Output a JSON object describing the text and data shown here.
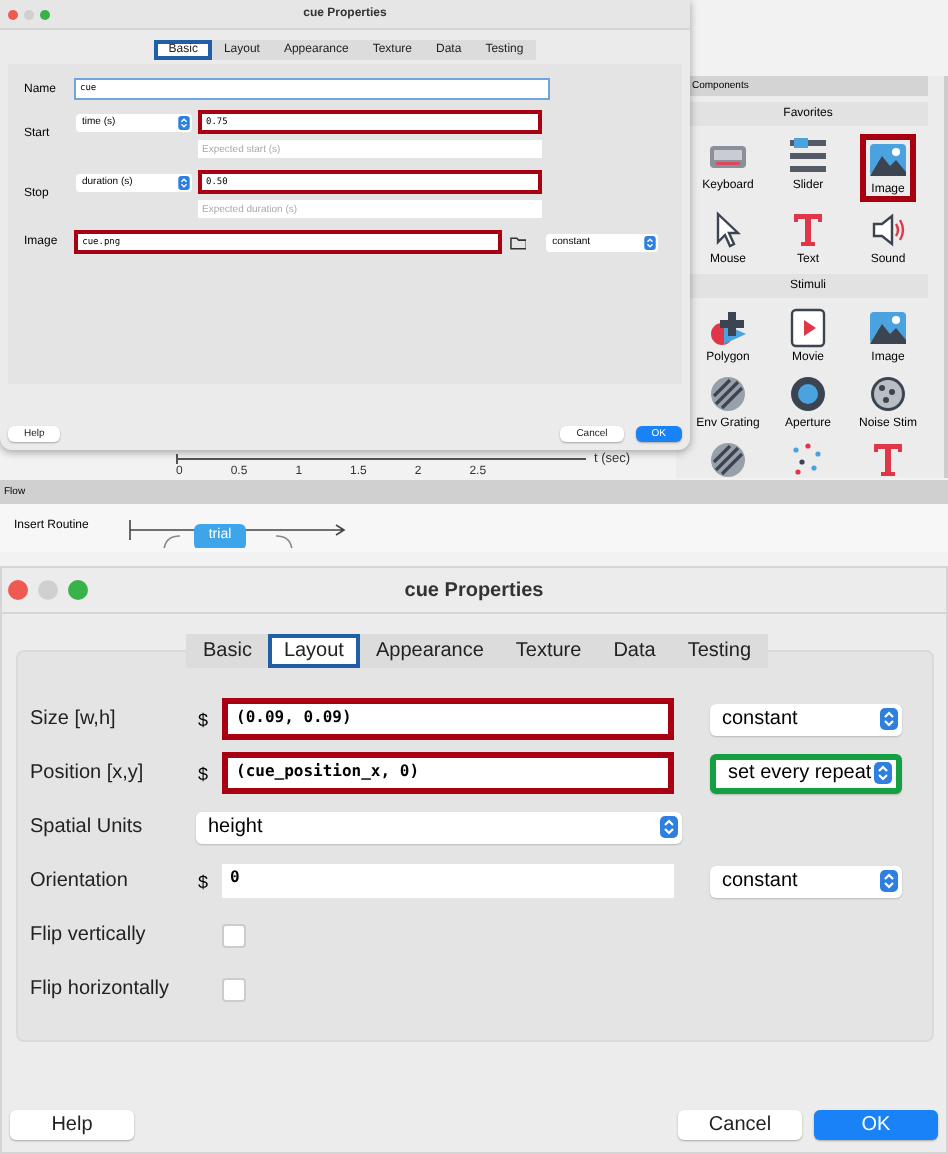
{
  "top_dialog": {
    "title": "cue Properties",
    "tabs": [
      {
        "label": "Basic",
        "selected": true,
        "color": "#1f5fa8"
      },
      {
        "label": "Layout",
        "selected": false
      },
      {
        "label": "Appearance",
        "selected": false
      },
      {
        "label": "Texture",
        "selected": false
      },
      {
        "label": "Data",
        "selected": false
      },
      {
        "label": "Testing",
        "selected": false
      }
    ],
    "name": {
      "label": "Name",
      "value": "cue"
    },
    "timing": [
      {
        "label": "Start",
        "type": "time (s)",
        "value": "0.75",
        "placeholder": "Expected start (s)",
        "color": "#a80010"
      },
      {
        "label": "Stop",
        "type": "duration (s)",
        "value": "0.50",
        "placeholder": "Expected duration (s)",
        "color": "#a80010"
      }
    ],
    "image": {
      "label": "Image",
      "value": "cue.png",
      "update": "constant",
      "color": "#a80010"
    },
    "buttons": {
      "help": "Help",
      "cancel": "Cancel",
      "ok": "OK"
    }
  },
  "timeline": {
    "ticks": [
      "0",
      "0.5",
      "1",
      "1.5",
      "2",
      "2.5"
    ],
    "axis_label": "t (sec)"
  },
  "components": {
    "title": "Components",
    "sections": [
      {
        "title": "Favorites",
        "items": [
          {
            "label": "Keyboard",
            "kind": "keyboard"
          },
          {
            "label": "Slider",
            "kind": "slider"
          },
          {
            "label": "Image",
            "kind": "image",
            "color": "#a80010"
          },
          {
            "label": "Mouse",
            "kind": "mouse"
          },
          {
            "label": "Text",
            "kind": "text"
          },
          {
            "label": "Sound",
            "kind": "sound"
          }
        ]
      },
      {
        "title": "Stimuli",
        "items": [
          {
            "label": "Polygon",
            "kind": "polygon"
          },
          {
            "label": "Movie",
            "kind": "movie"
          },
          {
            "label": "Image",
            "kind": "image"
          },
          {
            "label": "Env Grating",
            "kind": "grating"
          },
          {
            "label": "Aperture",
            "kind": "aperture"
          },
          {
            "label": "Noise Stim",
            "kind": "noise"
          },
          {
            "kind": "grating"
          },
          {
            "kind": "dots"
          },
          {
            "kind": "text"
          }
        ]
      }
    ]
  },
  "flow": {
    "title": "Flow",
    "insert": "Insert Routine",
    "routines": [
      "trial"
    ]
  },
  "dialog": {
    "title": "cue Properties",
    "tabs": [
      {
        "label": "Basic",
        "selected": false
      },
      {
        "label": "Layout",
        "selected": true,
        "color": "#1f5fa8"
      },
      {
        "label": "Appearance",
        "selected": false
      },
      {
        "label": "Texture",
        "selected": false
      },
      {
        "label": "Data",
        "selected": false
      },
      {
        "label": "Testing",
        "selected": false
      }
    ],
    "rows": [
      {
        "kind": "field",
        "label": "Size [w,h]",
        "prefix": "$",
        "value": "(0.09, 0.09)",
        "color": "#a80010",
        "update": {
          "label": "constant"
        }
      },
      {
        "kind": "field",
        "label": "Position [x,y]",
        "prefix": "$",
        "value": "(cue_position_x, 0)",
        "color": "#a80010",
        "update": {
          "label": "set every repeat",
          "color": "#14a040"
        }
      },
      {
        "kind": "select",
        "label": "Spatial Units",
        "value": "height"
      },
      {
        "kind": "field",
        "label": "Orientation",
        "prefix": "$",
        "value": "0",
        "update": {
          "label": "constant"
        }
      },
      {
        "kind": "checkbox",
        "label": "Flip vertically",
        "checked": false
      },
      {
        "kind": "checkbox",
        "label": "Flip horizontally",
        "checked": false
      }
    ],
    "buttons": {
      "help": "Help",
      "cancel": "Cancel",
      "ok": "OK"
    }
  }
}
